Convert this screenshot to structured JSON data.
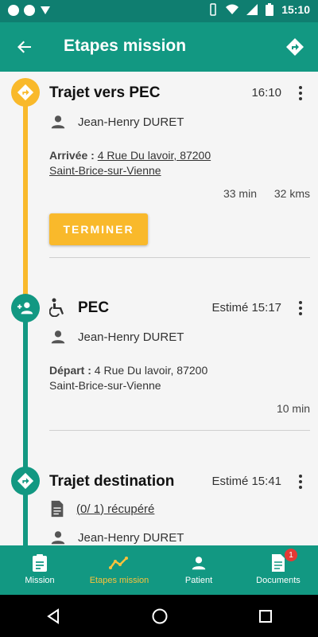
{
  "status_bar": {
    "time": "15:10"
  },
  "app_bar": {
    "title": "Etapes mission"
  },
  "steps": [
    {
      "title": "Trajet vers PEC",
      "time": "16:10",
      "person": "Jean-Henry DURET",
      "address_label": "Arrivée :",
      "address_line1": "4 Rue Du lavoir, 87200",
      "address_line2": "Saint-Brice-sur-Vienne",
      "duration": "33 min",
      "distance": "32 kms",
      "action": "TERMINER"
    },
    {
      "title": "PEC",
      "time": "Estimé 15:17",
      "person": "Jean-Henry DURET",
      "address_label": "Départ :",
      "address_line1": "4 Rue Du lavoir, 87200",
      "address_line2": "Saint-Brice-sur-Vienne",
      "duration": "10 min"
    },
    {
      "title": "Trajet destination",
      "time": "Estimé 15:41",
      "documents": "(0/ 1) récupéré",
      "person": "Jean-Henry DURET"
    }
  ],
  "bottom_nav": {
    "items": [
      {
        "label": "Mission",
        "icon": "clipboard-icon"
      },
      {
        "label": "Etapes mission",
        "icon": "timeline-icon",
        "active": true
      },
      {
        "label": "Patient",
        "icon": "person-icon"
      },
      {
        "label": "Documents",
        "icon": "document-icon",
        "badge": "1"
      }
    ]
  },
  "colors": {
    "primary": "#129882",
    "status_bar": "#0f7e70",
    "accent": "#f9b92b",
    "badge": "#e53935"
  }
}
